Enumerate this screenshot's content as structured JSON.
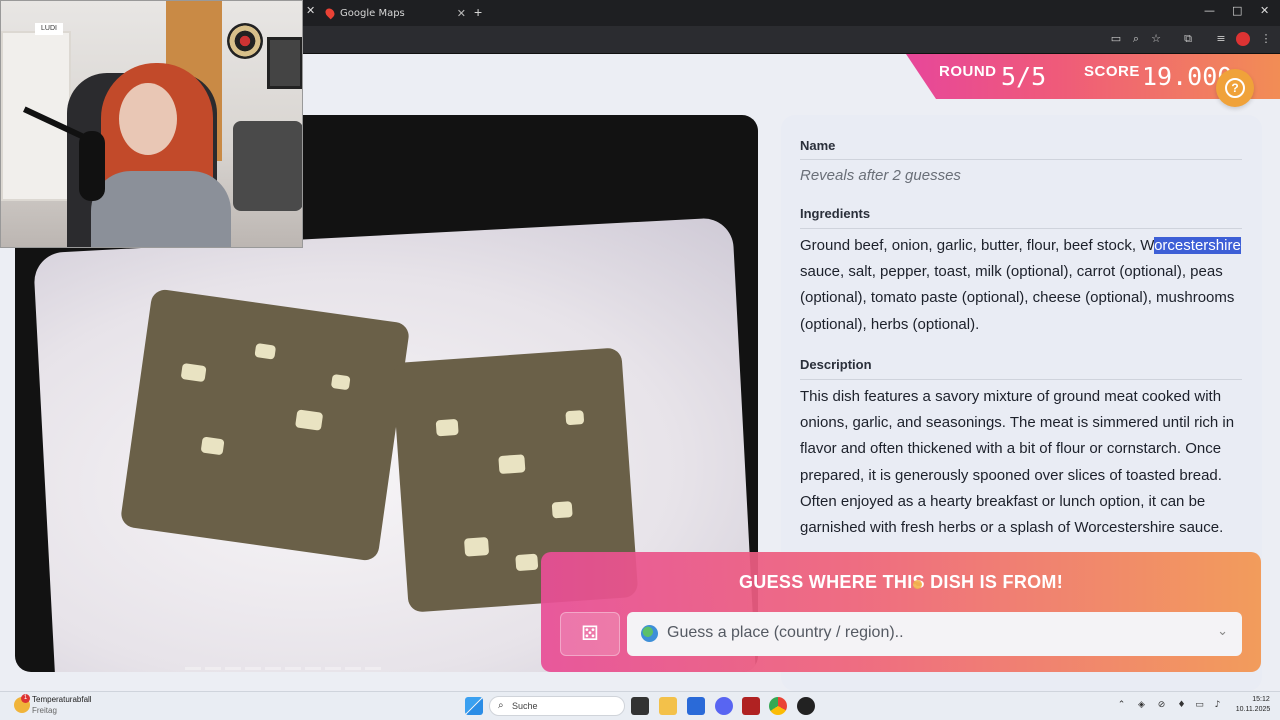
{
  "browser": {
    "tabs": [
      {
        "label": "Google Maps"
      }
    ],
    "new_tab": "+",
    "window_controls": {
      "minimize": "—",
      "maximize": "□",
      "close": "✕"
    }
  },
  "game": {
    "round_label": "ROUND",
    "round_value": "5/5",
    "score_label": "SCORE",
    "score_value": "19.000",
    "name_heading": "Name",
    "name_placeholder": "Reveals after 2 guesses",
    "ingredients_heading": "Ingredients",
    "ingredients_text_before": "Ground beef, onion, garlic, butter, flour, beef stock, W",
    "ingredients_highlight": "orcestershire",
    "ingredients_text_after": " sauce, salt, pepper, toast, milk (optional), carrot (optional), peas (optional), tomato paste (optional), cheese (optional), mushrooms (optional), herbs (optional).",
    "description_heading": "Description",
    "description_text": "This dish features a savory mixture of ground meat cooked with onions, garlic, and seasonings. The meat is simmered until rich in flavor and often thickened with a bit of flour or cornstarch. Once prepared, it is generously spooned over slices of toasted bread. Often enjoyed as a hearty breakfast or lunch option, it can be garnished with fresh herbs or a splash of Worcestershire sauce.",
    "guess_title": "GUESS WHERE THIS DISH IS FROM!",
    "guess_placeholder": "Guess a place (country / region)..",
    "help_glyph": "?"
  },
  "webcam": {
    "sign_text": "LUDI"
  },
  "taskbar": {
    "weather_title": "Temperaturabfall",
    "weather_sub": "Freitag",
    "weather_badge": "1",
    "search_label": "Suche",
    "time": "15:12",
    "date": "10.11.2025"
  },
  "colors": {
    "accent_gradient_start": "#e7479a",
    "accent_gradient_end": "#f28d55",
    "help_button": "#f0a23a",
    "highlight": "#3d5fd6"
  },
  "icons": [
    "google-maps-icon",
    "close-icon",
    "zoom-icon",
    "bookmark-star-icon",
    "extensions-icon",
    "help-icon",
    "dice-icon",
    "globe-icon",
    "chevron-down-icon",
    "windows-start-icon",
    "search-icon"
  ]
}
